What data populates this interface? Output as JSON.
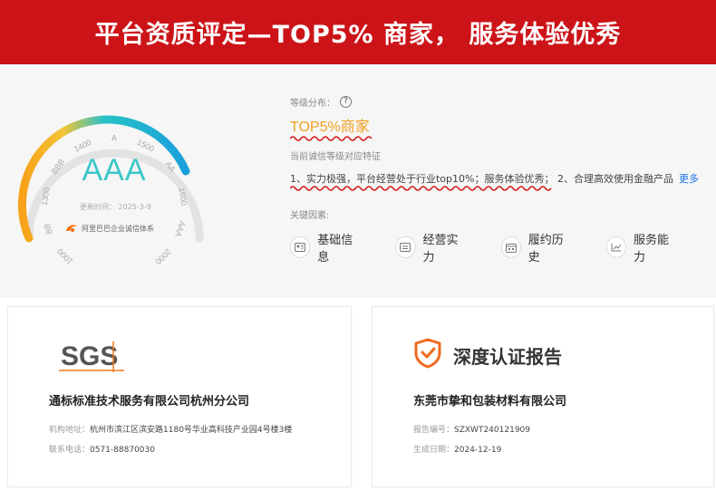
{
  "banner": {
    "title": "平台资质评定—TOP5% 商家， 服务体验优秀"
  },
  "gauge": {
    "grade": "AAA",
    "date": "更新时间： 2025-3-9",
    "org": "阿里巴巴企业诚信体系",
    "ticks": [
      "1000",
      "BB",
      "1300",
      "BBB",
      "1400",
      "A",
      "1500",
      "AA",
      "1600",
      "AAA",
      "2000"
    ],
    "colors": {
      "start": "#f7a21a",
      "mid": "#28c2c7",
      "end": "#1a9fdb"
    }
  },
  "level": {
    "label": "等级分布：",
    "help": "?",
    "value": "TOP5%商家"
  },
  "feature": {
    "label": "当前诚信等级对应特征",
    "text": "1、实力极强，平台经营处于行业top10%；服务体验优秀； 2、合理高效使用金融产品",
    "more": "更多"
  },
  "key": {
    "label": "关键因素:",
    "factors": [
      {
        "label": "基础信息",
        "icon": "id-card-icon"
      },
      {
        "label": "经营实力",
        "icon": "store-icon"
      },
      {
        "label": "履约历史",
        "icon": "calendar-icon"
      },
      {
        "label": "服务能力",
        "icon": "chart-icon"
      }
    ]
  },
  "sgs": {
    "logo": "SGS",
    "name": "通标标准技术服务有限公司杭州分公司",
    "address_label": "机构地址：",
    "address": "杭州市滨江区滨安路1180号华业高科技产业园4号楼3楼",
    "phone_label": "联系电话：",
    "phone": "0571-88870030"
  },
  "report": {
    "title": "深度认证报告",
    "name": "东莞市挚和包装材料有限公司",
    "number_label": "报告编号：",
    "number": "SZXWT240121909",
    "date_label": "生成日期：",
    "date": "2024-12-19",
    "accent": "#f06a1e"
  }
}
